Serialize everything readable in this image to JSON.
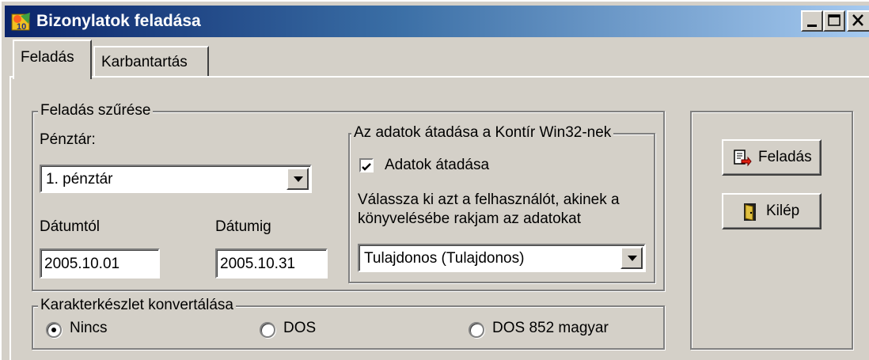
{
  "window": {
    "title": "Bizonylatok feladása",
    "app_icon": "feladas-app-icon",
    "controls": [
      "minimize-icon",
      "maximize-icon",
      "close-icon"
    ]
  },
  "tabs": [
    {
      "label": "Feladás",
      "active": true
    },
    {
      "label": "Karbantartás",
      "active": false
    }
  ],
  "filter": {
    "group_title": "Feladás szűrése",
    "cashbox_label": "Pénztár:",
    "cashbox_value": "1. pénztár",
    "date_from_label": "Dátumtól",
    "date_from_value": "2005.10.01",
    "date_to_label": "Dátumig",
    "date_to_value": "2005.10.31"
  },
  "transfer": {
    "group_title": "Az adatok átadása a Kontír Win32-nek",
    "checkbox_label": "Adatok átadása",
    "checked": true,
    "instruction_line1": "Válassza ki azt a felhasználót, akinek a",
    "instruction_line2": "könyvelésébe rakjam az adatokat",
    "user_value": "Tulajdonos (Tulajdonos)"
  },
  "charset": {
    "group_title": "Karakterkészlet konvertálása",
    "options": [
      {
        "label": "Nincs",
        "selected": true
      },
      {
        "label": "DOS",
        "selected": false
      },
      {
        "label": "DOS 852 magyar",
        "selected": false
      }
    ]
  },
  "actions": {
    "submit_label": "Feladás",
    "submit_icon": "document-arrow-icon",
    "exit_label": "Kilép",
    "exit_icon": "door-icon"
  },
  "colors": {
    "titlebar_start": "#0a246a",
    "titlebar_end": "#a6caf0",
    "face": "#d4d0c8"
  }
}
